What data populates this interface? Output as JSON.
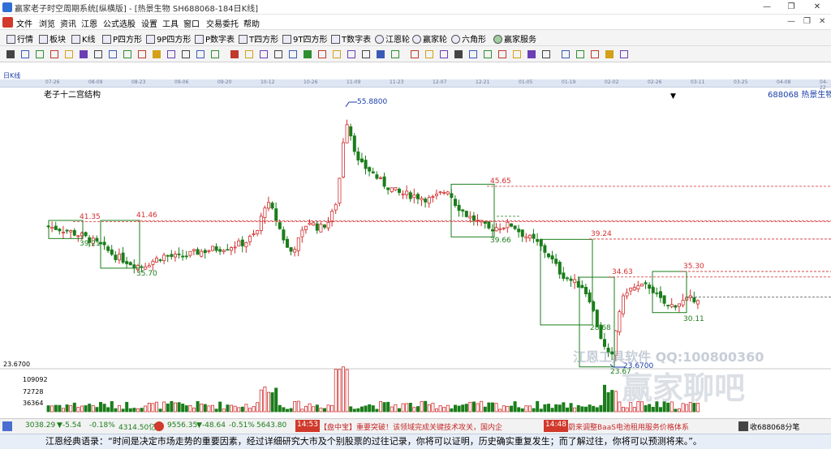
{
  "window": {
    "title": "赢家老子时空周期系统[纵横版] - [热景生物  SH688068-184日K线]",
    "minimize": "—",
    "restore": "❐",
    "close": "✕"
  },
  "menu": [
    "文件",
    "浏览",
    "资讯",
    "江恩",
    "公式选股",
    "设置",
    "工具",
    "窗口",
    "交易委托",
    "帮助"
  ],
  "mdi_controls": {
    "min": "—",
    "restore": "❐",
    "close": "✕"
  },
  "toolbar1": [
    {
      "label": "行情",
      "icon": "grid-icon"
    },
    {
      "label": "板块",
      "icon": "blocks-icon"
    },
    {
      "label": "K线",
      "icon": "kline-icon"
    },
    {
      "label": "P四方形",
      "icon": "p-square-icon"
    },
    {
      "label": "9P四方形",
      "icon": "9p-square-icon"
    },
    {
      "label": "P数字表",
      "icon": "p-number-table-icon"
    },
    {
      "label": "T四方形",
      "icon": "t-square-icon"
    },
    {
      "label": "9T四方形",
      "icon": "9t-square-icon"
    },
    {
      "label": "T数字表",
      "icon": "t-number-table-icon"
    },
    {
      "label": "江恩轮",
      "icon": "gann-wheel-icon"
    },
    {
      "label": "赢家轮",
      "icon": "winner-wheel-icon"
    },
    {
      "label": "六角形",
      "icon": "hexagon-icon"
    },
    {
      "label": "赢家服务",
      "icon": "service-icon"
    }
  ],
  "toolbar2_count": 42,
  "period_label": "日K线",
  "chart_title": "老子十二宫结构",
  "stock_label": "688068 热景生物",
  "date_ticks": [
    "07-26",
    "08-09",
    "08-23",
    "09-06",
    "09-20",
    "10-12",
    "10-26",
    "11-09",
    "11-23",
    "12-07",
    "12-21",
    "01-05",
    "01-19",
    "02-02",
    "02-26",
    "03-11",
    "03-25",
    "04-08",
    "04-22"
  ],
  "levels": [
    "41.35",
    "41.46",
    "39.21",
    "35.70",
    "55.8800",
    "45.65",
    "39.66",
    "39.24",
    "34.63",
    "35.30",
    "30.11",
    "28.68",
    "23.67",
    "23.6700"
  ],
  "volume_axis": [
    "23.6700",
    "109092",
    "72728",
    "36364"
  ],
  "watermark": {
    "line1": "江恩工具软件 QQ:100800360",
    "line2": "赢家聊吧"
  },
  "status": {
    "sh_index": "3038.29",
    "sh_change": "▼-5.54",
    "sh_pct": "-0.18%",
    "sh_amount": "4314.50亿",
    "sz_index": "9556.35",
    "sz_change": "▼-48.64",
    "sz_pct": "-0.51%",
    "sz_amount": "5643.80",
    "news_time_1": "14:53",
    "news_1": "【盘中宝】重要突破！该领域完成关键技术攻关，国内企",
    "news_time_2": "14:48",
    "news_2": "蔚来调整BaaS电池租用服务价格体系",
    "right_text": "收688068分笔"
  },
  "footer_quote": "江恩经典语录：“时间是决定市场走势的重要因素，经过详细研究大市及个别股票的过往记录，你将可以证明，历史确实重复发生；而了解过往，你将可以预测将来。”。",
  "chart_data": {
    "type": "candlestick",
    "title": "老子十二宫结构",
    "symbol": "688068 热景生物",
    "period": "日K线",
    "x_ticks": [
      "07-26",
      "08-09",
      "08-23",
      "09-06",
      "09-20",
      "10-12",
      "10-26",
      "11-09",
      "11-23",
      "12-07",
      "12-21",
      "01-05",
      "01-19",
      "02-02",
      "02-26",
      "03-11",
      "03-25",
      "04-08",
      "04-22"
    ],
    "price_labels": {
      "high": 55.88,
      "low": 23.67
    },
    "levels": [
      41.35,
      41.46,
      39.21,
      35.7,
      45.65,
      39.66,
      39.24,
      34.63,
      35.3,
      30.11,
      28.68,
      23.67
    ],
    "volume_axis": [
      109092,
      72728,
      36364
    ],
    "colors": {
      "up": "#d32f2f",
      "down": "#1b7d1b",
      "level": "#d32f2f",
      "box": "#1b7d1b"
    }
  }
}
